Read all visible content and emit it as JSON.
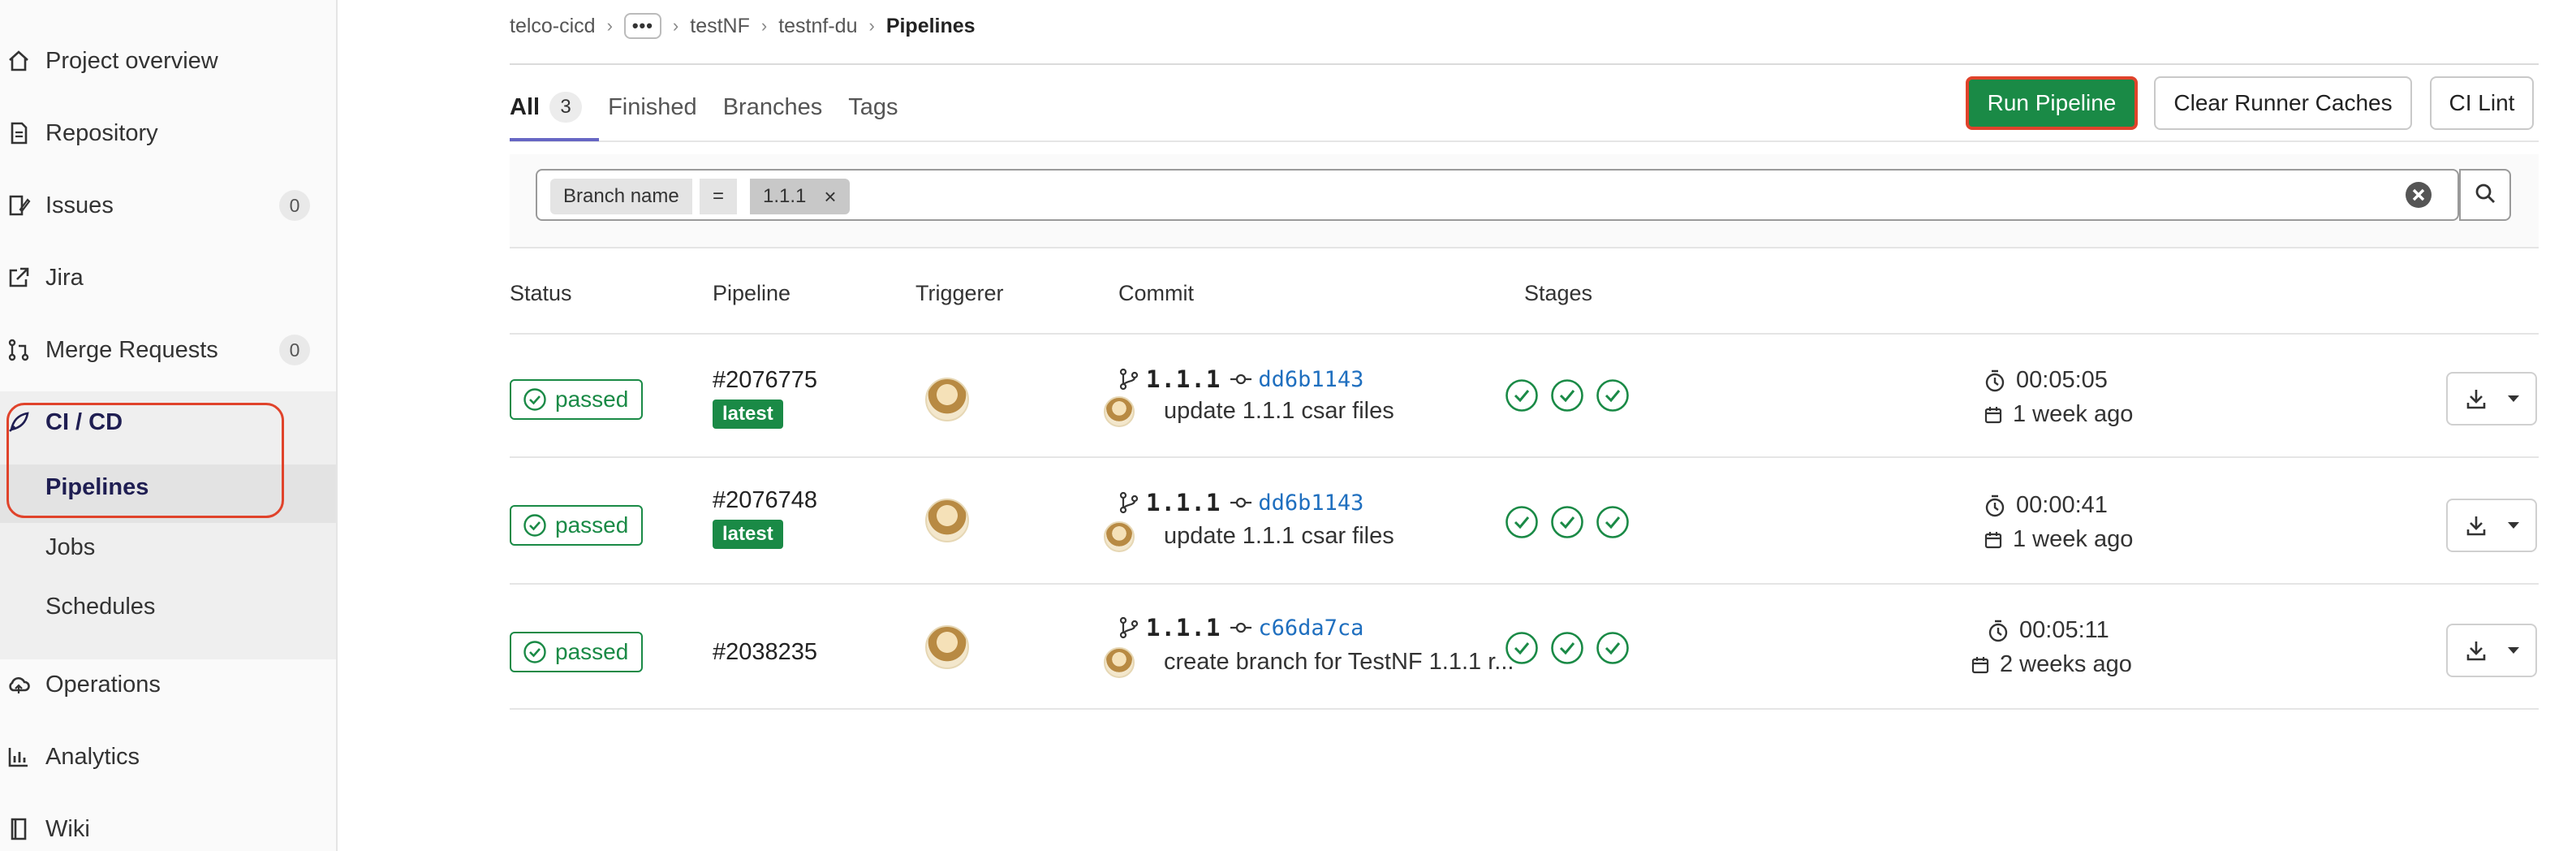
{
  "sidebar": {
    "items": [
      {
        "label": "Project overview"
      },
      {
        "label": "Repository"
      },
      {
        "label": "Issues",
        "count": "0"
      },
      {
        "label": "Jira"
      },
      {
        "label": "Merge Requests",
        "count": "0"
      },
      {
        "label": "CI / CD"
      },
      {
        "label": "Operations"
      },
      {
        "label": "Analytics"
      },
      {
        "label": "Wiki"
      }
    ],
    "cicd_sub": [
      "Pipelines",
      "Jobs",
      "Schedules"
    ]
  },
  "breadcrumb": [
    "telco-cicd",
    "•••",
    "testNF",
    "testnf-du",
    "Pipelines"
  ],
  "tabs": [
    {
      "label": "All",
      "count": "3"
    },
    {
      "label": "Finished"
    },
    {
      "label": "Branches"
    },
    {
      "label": "Tags"
    }
  ],
  "actions": {
    "run": "Run Pipeline",
    "clear": "Clear Runner Caches",
    "lint": "CI Lint"
  },
  "filter": {
    "name": "Branch name",
    "operator": "=",
    "value": "1.1.1",
    "remove": "×"
  },
  "table": {
    "headers": [
      "Status",
      "Pipeline",
      "Triggerer",
      "Commit",
      "Stages"
    ],
    "rows": [
      {
        "status": "passed",
        "id": "#2076775",
        "latest": "latest",
        "ref": "1.1.1",
        "sha": "dd6b1143",
        "message": "update 1.1.1 csar files",
        "duration": "00:05:05",
        "finished": "1 week ago"
      },
      {
        "status": "passed",
        "id": "#2076748",
        "latest": "latest",
        "ref": "1.1.1",
        "sha": "dd6b1143",
        "message": "update 1.1.1 csar files",
        "duration": "00:00:41",
        "finished": "1 week ago"
      },
      {
        "status": "passed",
        "id": "#2038235",
        "latest": "",
        "ref": "1.1.1",
        "sha": "c66da7ca",
        "message": "create branch for TestNF 1.1.1 r...",
        "duration": "00:05:11",
        "finished": "2 weeks ago"
      }
    ]
  },
  "colors": {
    "success": "#1a8a46",
    "link": "#1f6fbf",
    "highlight": "#e0432b",
    "active_nav": "#1f1e52"
  }
}
